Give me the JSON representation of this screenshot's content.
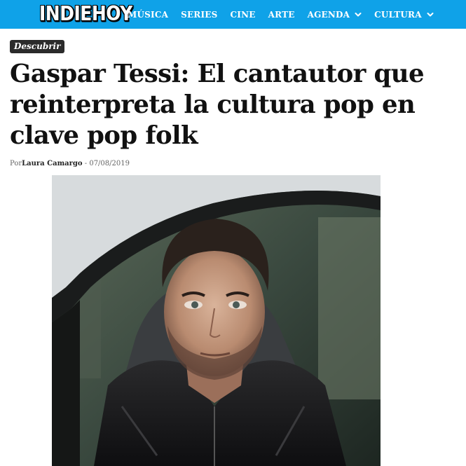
{
  "header": {
    "logo_text": "INDIEHOY",
    "nav": [
      {
        "label": "MÚSICA",
        "dropdown": false
      },
      {
        "label": "SERIES",
        "dropdown": false
      },
      {
        "label": "CINE",
        "dropdown": false
      },
      {
        "label": "ARTE",
        "dropdown": false
      },
      {
        "label": "AGENDA",
        "dropdown": true
      },
      {
        "label": "CULTURA",
        "dropdown": true
      }
    ],
    "bar_color": "#0fa2e8"
  },
  "article": {
    "category": "Descubrir",
    "title": "Gaspar Tessi: El cantautor que reinterpreta la cultura pop en clave pop folk",
    "byline_prefix": "Por",
    "author": "Laura Camargo",
    "separator": " - ",
    "date": "07/08/2019"
  },
  "icons": {
    "dropdown": "chevron-down-icon"
  }
}
